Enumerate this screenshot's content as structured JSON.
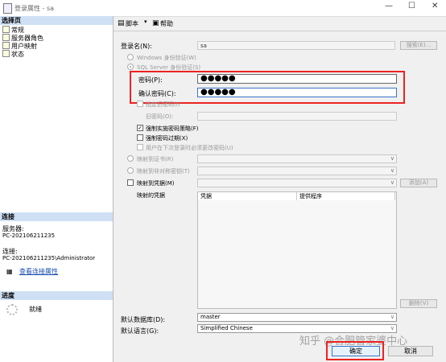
{
  "window": {
    "title": "登录属性 - sa",
    "controls": [
      "—",
      "☐",
      "✕"
    ]
  },
  "left_pane": {
    "select_page_heading": "选择页",
    "pages": [
      "常规",
      "服务器角色",
      "用户映射",
      "状态"
    ],
    "connection_heading": "连接",
    "server_label": "服务器:",
    "server_value": "PC-202106211235",
    "connection_label": "连接:",
    "connection_value": "PC-202106211235\\Administrator",
    "view_properties_link": "查看连接属性",
    "progress_heading": "进度",
    "progress_status": "就绪"
  },
  "toolbar": {
    "script_label": "脚本",
    "help_label": "帮助"
  },
  "form": {
    "login_name_label": "登录名(N):",
    "login_name_value": "sa",
    "search_button": "搜索(E)...",
    "windows_auth_label": "Windows 身份验证(W)",
    "sql_auth_label": "SQL Server 身份验证(S)",
    "password_label": "密码(P):",
    "password_value": "●●●●●",
    "confirm_password_label": "确认密码(C):",
    "confirm_password_value": "●●●●●",
    "specify_old_password_label": "指定旧密码(I)",
    "old_password_label": "旧密码(O):",
    "enforce_policy_label": "强制实施密码策略(F)",
    "enforce_policy_checked": true,
    "enforce_expiration_label": "强制密码过期(X)",
    "must_change_label": "用户在下次登录时必须更改密码(U)",
    "map_certificate_label": "映射到证书(R)",
    "map_asymmetric_key_label": "映射到非对称密钥(T)",
    "map_credential_label": "映射到凭据(M)",
    "add_button": "添加(A)",
    "mapped_credentials_label": "映射的凭据",
    "grid_col_credential": "凭据",
    "grid_col_provider": "提供程序",
    "remove_button": "删除(V)",
    "default_database_label": "默认数据库(D):",
    "default_database_value": "master",
    "default_language_label": "默认语言(G):",
    "default_language_value": "Simplified Chinese"
  },
  "footer": {
    "ok_button": "确定",
    "cancel_button": "取消",
    "watermark": "知乎 @合肥管家婆中心"
  },
  "colors": {
    "highlight_red": "#e22222",
    "section_header": "#cfe0f4"
  }
}
